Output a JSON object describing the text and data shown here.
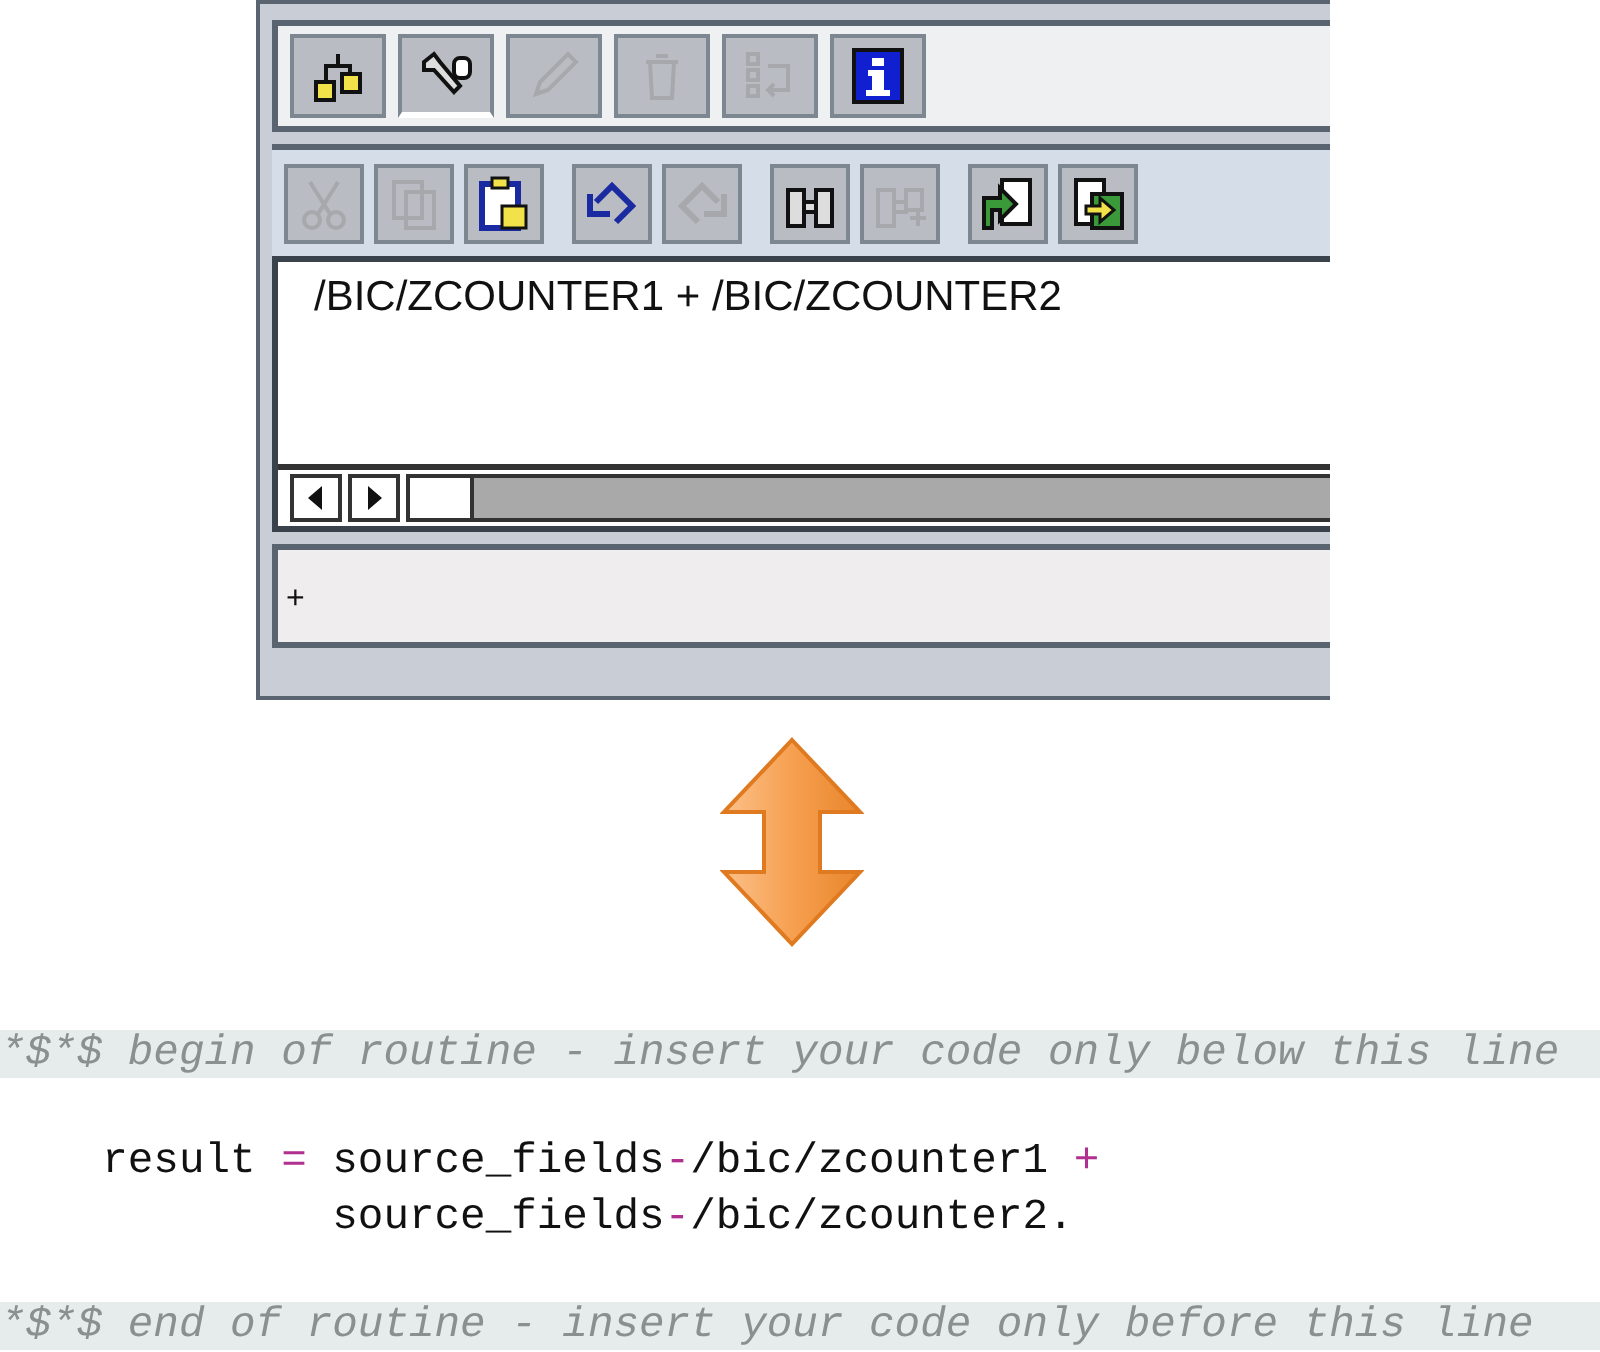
{
  "toolbar": {
    "buttons": [
      {
        "kind": "hierarchy",
        "disabled": false,
        "selected": false
      },
      {
        "kind": "tools",
        "disabled": false,
        "selected": true
      },
      {
        "kind": "pencil",
        "disabled": true,
        "selected": false
      },
      {
        "kind": "trash",
        "disabled": true,
        "selected": false
      },
      {
        "kind": "reorder",
        "disabled": true,
        "selected": false
      },
      {
        "kind": "info",
        "disabled": false,
        "selected": false
      }
    ]
  },
  "editor_toolbar": {
    "groups": [
      [
        {
          "kind": "cut",
          "disabled": true
        },
        {
          "kind": "copy",
          "disabled": true
        },
        {
          "kind": "paste",
          "disabled": false
        }
      ],
      [
        {
          "kind": "undo",
          "disabled": false
        },
        {
          "kind": "redo",
          "disabled": true
        }
      ],
      [
        {
          "kind": "find",
          "disabled": false
        },
        {
          "kind": "find-next",
          "disabled": true
        }
      ],
      [
        {
          "kind": "import",
          "disabled": false
        },
        {
          "kind": "export",
          "disabled": false
        }
      ]
    ]
  },
  "editor": {
    "formula": "/BIC/ZCOUNTER1 + /BIC/ZCOUNTER2"
  },
  "status_bar": {
    "text": "+"
  },
  "code": {
    "lines": [
      {
        "kind": "comment",
        "tokens": [
          {
            "text": "*$*$ begin of routine - insert your code only below this line",
            "kind": "comment"
          }
        ]
      },
      {
        "kind": "blank"
      },
      {
        "kind": "code",
        "tokens": [
          {
            "text": "    result ",
            "kind": "plain"
          },
          {
            "text": "=",
            "kind": "operator"
          },
          {
            "text": " source_fields",
            "kind": "plain"
          },
          {
            "text": "-",
            "kind": "operator"
          },
          {
            "text": "/bic/zcounter1 ",
            "kind": "plain"
          },
          {
            "text": "+",
            "kind": "operator"
          }
        ]
      },
      {
        "kind": "code",
        "tokens": [
          {
            "text": "             source_fields",
            "kind": "plain"
          },
          {
            "text": "-",
            "kind": "operator"
          },
          {
            "text": "/bic/zcounter2.",
            "kind": "plain"
          }
        ]
      },
      {
        "kind": "blank"
      },
      {
        "kind": "comment",
        "tokens": [
          {
            "text": "*$*$ end of routine - insert your code only before this line",
            "kind": "comment"
          }
        ]
      }
    ]
  }
}
